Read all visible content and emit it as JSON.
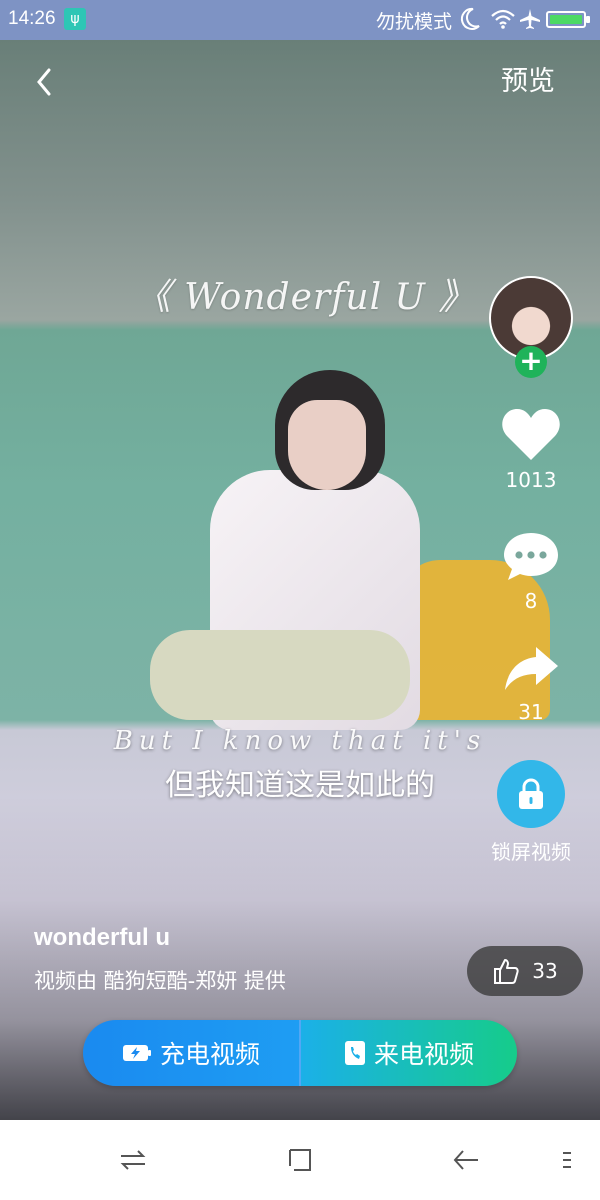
{
  "status_bar": {
    "time": "14:26",
    "dnd_label": "勿扰模式"
  },
  "top_bar": {
    "preview_label": "预览"
  },
  "video": {
    "title": "《 Wonderful U 》",
    "subtitle_en": "But I know that it's",
    "subtitle_zh": "但我知道这是如此的"
  },
  "rail": {
    "like_count": "1013",
    "comment_count": "8",
    "share_count": "31",
    "lock_label": "锁屏视频"
  },
  "info": {
    "title": "wonderful u",
    "provider": "视频由 酷狗短酷-郑妍 提供",
    "thumbs_count": "33"
  },
  "actions": {
    "charge_label": "充电视频",
    "incoming_label": "来电视频"
  },
  "colors": {
    "status_bar": "#7e93c4",
    "follow_green": "#1fb35a",
    "lock_blue": "#32b7e9",
    "charge_blue": "#1a8af0",
    "incoming_green": "#16cc8a"
  }
}
